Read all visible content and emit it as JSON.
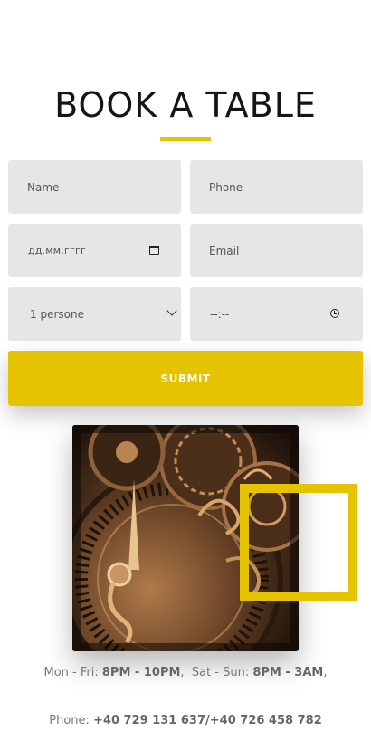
{
  "heading": {
    "title": "BOOK A TABLE"
  },
  "form": {
    "name_placeholder": "Name",
    "phone_placeholder": "Phone",
    "date_placeholder": "дд.мм.гггг",
    "email_placeholder": "Email",
    "persons_selected": "1 persone",
    "time_placeholder": "--:--",
    "submit_label": "SUBMIT"
  },
  "info": {
    "weekday_label": "Mon - Fri:",
    "weekday_hours": "8PM - 10PM",
    "weekend_label": "Sat - Sun:",
    "weekend_hours": "8PM - 3AM",
    "phone_label": "Phone:",
    "phone_numbers": "+40 729 131 637/+40 726 458 782"
  },
  "icons": {
    "date": "calendar-icon",
    "select": "chevron-down-icon",
    "time": "clock-icon"
  },
  "colors": {
    "accent": "#e5c300",
    "field_bg": "#e6e6e6",
    "title": "#151515",
    "muted_text": "#777777"
  }
}
